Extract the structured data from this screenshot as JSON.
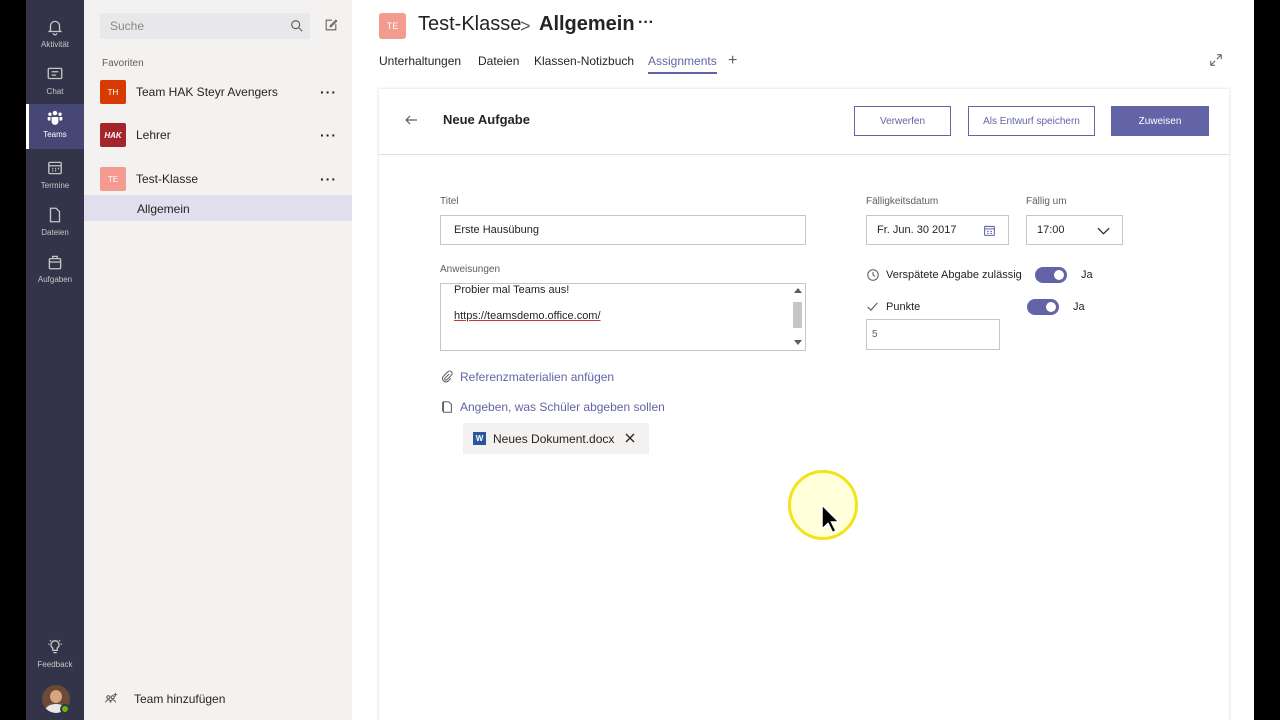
{
  "rail": {
    "items": [
      {
        "label": "Aktivität",
        "icon": "bell-icon"
      },
      {
        "label": "Chat",
        "icon": "chat-icon"
      },
      {
        "label": "Teams",
        "icon": "teams-icon",
        "active": true
      },
      {
        "label": "Termine",
        "icon": "calendar-icon"
      },
      {
        "label": "Dateien",
        "icon": "file-icon"
      },
      {
        "label": "Aufgaben",
        "icon": "briefcase-icon"
      },
      {
        "label": "Feedback",
        "icon": "lightbulb-icon"
      }
    ]
  },
  "sidebar": {
    "search_placeholder": "Suche",
    "favorites_label": "Favoriten",
    "teams": [
      {
        "initials": "TH",
        "name": "Team HAK Steyr Avengers",
        "color": "#d83b01"
      },
      {
        "initials": "HAK",
        "name": "Lehrer",
        "color": "#a4262c"
      },
      {
        "initials": "TE",
        "name": "Test-Klasse",
        "color": "#f29b8e"
      }
    ],
    "channel": "Allgemein",
    "add_team": "Team hinzufügen"
  },
  "header": {
    "avatar_initials": "TE",
    "team": "Test-Klasse",
    "separator": ">",
    "channel": "Allgemein",
    "tabs": [
      "Unterhaltungen",
      "Dateien",
      "Klassen-Notizbuch",
      "Assignments"
    ],
    "active_tab": "Assignments"
  },
  "assignment": {
    "title": "Neue Aufgabe",
    "buttons": {
      "discard": "Verwerfen",
      "draft": "Als Entwurf speichern",
      "assign": "Zuweisen"
    },
    "title_label": "Titel",
    "title_value": "Erste Hausübung",
    "instructions_label": "Anweisungen",
    "instructions_line1": "Probier mal Teams aus!",
    "instructions_line2": "https://teamsdemo.office.com/",
    "reference_link": "Referenzmaterialien anfügen",
    "submit_link": "Angeben, was Schüler abgeben sollen",
    "attachment": "Neues Dokument.docx",
    "due_date_label": "Fälligkeitsdatum",
    "due_date_value": "Fr. Jun. 30 2017",
    "due_time_label": "Fällig um",
    "due_time_value": "17:00",
    "late_label": "Verspätete Abgabe zulässig",
    "late_value": "Ja",
    "points_label": "Punkte",
    "points_toggle_value": "Ja",
    "points_value": "5"
  },
  "colors": {
    "accent": "#6264a7",
    "rail": "#33344a"
  }
}
